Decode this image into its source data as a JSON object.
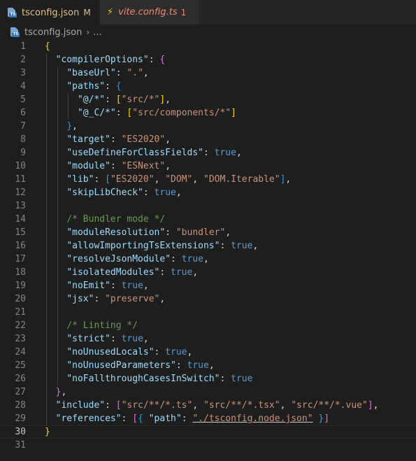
{
  "tabs": [
    {
      "label": "tsconfig.json",
      "status": "M",
      "icon": "ts-file-icon",
      "active": true,
      "dirty": true
    },
    {
      "label": "vite.config.ts",
      "problems": "1",
      "icon": "lightning-bolt-icon",
      "active": false
    }
  ],
  "breadcrumb": {
    "file": "tsconfig.json",
    "separator": "›",
    "ellipsis": "..."
  },
  "lines": [
    {
      "n": "1",
      "indent": 0,
      "tokens": [
        [
          "br1",
          "{"
        ]
      ]
    },
    {
      "n": "2",
      "indent": 2,
      "tokens": [
        [
          "k",
          "\"compilerOptions\""
        ],
        [
          "p",
          ": "
        ],
        [
          "br2",
          "{"
        ]
      ]
    },
    {
      "n": "3",
      "indent": 4,
      "tokens": [
        [
          "k",
          "\"baseUrl\""
        ],
        [
          "p",
          ": "
        ],
        [
          "s",
          "\".\""
        ],
        [
          "p",
          ","
        ]
      ]
    },
    {
      "n": "4",
      "indent": 4,
      "tokens": [
        [
          "k",
          "\"paths\""
        ],
        [
          "p",
          ": "
        ],
        [
          "br3",
          "{"
        ]
      ]
    },
    {
      "n": "5",
      "indent": 6,
      "tokens": [
        [
          "k",
          "\"@/*\""
        ],
        [
          "p",
          ": "
        ],
        [
          "br1",
          "["
        ],
        [
          "s",
          "\"src/*\""
        ],
        [
          "br1",
          "]"
        ],
        [
          "p",
          ","
        ]
      ]
    },
    {
      "n": "6",
      "indent": 6,
      "tokens": [
        [
          "k",
          "\"@_C/*\""
        ],
        [
          "p",
          ": "
        ],
        [
          "br1",
          "["
        ],
        [
          "s",
          "\"src/components/*\""
        ],
        [
          "br1",
          "]"
        ]
      ]
    },
    {
      "n": "7",
      "indent": 4,
      "tokens": [
        [
          "br3",
          "}"
        ],
        [
          "p",
          ","
        ]
      ]
    },
    {
      "n": "8",
      "indent": 4,
      "tokens": [
        [
          "k",
          "\"target\""
        ],
        [
          "p",
          ": "
        ],
        [
          "s",
          "\"ES2020\""
        ],
        [
          "p",
          ","
        ]
      ]
    },
    {
      "n": "9",
      "indent": 4,
      "tokens": [
        [
          "k",
          "\"useDefineForClassFields\""
        ],
        [
          "p",
          ": "
        ],
        [
          "b",
          "true"
        ],
        [
          "p",
          ","
        ]
      ]
    },
    {
      "n": "10",
      "indent": 4,
      "tokens": [
        [
          "k",
          "\"module\""
        ],
        [
          "p",
          ": "
        ],
        [
          "s",
          "\"ESNext\""
        ],
        [
          "p",
          ","
        ]
      ]
    },
    {
      "n": "11",
      "indent": 4,
      "tokens": [
        [
          "k",
          "\"lib\""
        ],
        [
          "p",
          ": "
        ],
        [
          "br3",
          "["
        ],
        [
          "s",
          "\"ES2020\""
        ],
        [
          "p",
          ", "
        ],
        [
          "s",
          "\"DOM\""
        ],
        [
          "p",
          ", "
        ],
        [
          "s",
          "\"DOM.Iterable\""
        ],
        [
          "br3",
          "]"
        ],
        [
          "p",
          ","
        ]
      ]
    },
    {
      "n": "12",
      "indent": 4,
      "tokens": [
        [
          "k",
          "\"skipLibCheck\""
        ],
        [
          "p",
          ": "
        ],
        [
          "b",
          "true"
        ],
        [
          "p",
          ","
        ]
      ]
    },
    {
      "n": "13",
      "indent": 4,
      "tokens": []
    },
    {
      "n": "14",
      "indent": 4,
      "tokens": [
        [
          "c",
          "/* Bundler mode */"
        ]
      ]
    },
    {
      "n": "15",
      "indent": 4,
      "tokens": [
        [
          "k",
          "\"moduleResolution\""
        ],
        [
          "p",
          ": "
        ],
        [
          "s",
          "\"bundler\""
        ],
        [
          "p",
          ","
        ]
      ]
    },
    {
      "n": "16",
      "indent": 4,
      "tokens": [
        [
          "k",
          "\"allowImportingTsExtensions\""
        ],
        [
          "p",
          ": "
        ],
        [
          "b",
          "true"
        ],
        [
          "p",
          ","
        ]
      ]
    },
    {
      "n": "17",
      "indent": 4,
      "tokens": [
        [
          "k",
          "\"resolveJsonModule\""
        ],
        [
          "p",
          ": "
        ],
        [
          "b",
          "true"
        ],
        [
          "p",
          ","
        ]
      ]
    },
    {
      "n": "18",
      "indent": 4,
      "tokens": [
        [
          "k",
          "\"isolatedModules\""
        ],
        [
          "p",
          ": "
        ],
        [
          "b",
          "true"
        ],
        [
          "p",
          ","
        ]
      ]
    },
    {
      "n": "19",
      "indent": 4,
      "tokens": [
        [
          "k",
          "\"noEmit\""
        ],
        [
          "p",
          ": "
        ],
        [
          "b",
          "true"
        ],
        [
          "p",
          ","
        ]
      ]
    },
    {
      "n": "20",
      "indent": 4,
      "tokens": [
        [
          "k",
          "\"jsx\""
        ],
        [
          "p",
          ": "
        ],
        [
          "s",
          "\"preserve\""
        ],
        [
          "p",
          ","
        ]
      ]
    },
    {
      "n": "21",
      "indent": 4,
      "tokens": []
    },
    {
      "n": "22",
      "indent": 4,
      "tokens": [
        [
          "c",
          "/* Linting */"
        ]
      ]
    },
    {
      "n": "23",
      "indent": 4,
      "tokens": [
        [
          "k",
          "\"strict\""
        ],
        [
          "p",
          ": "
        ],
        [
          "b",
          "true"
        ],
        [
          "p",
          ","
        ]
      ]
    },
    {
      "n": "24",
      "indent": 4,
      "tokens": [
        [
          "k",
          "\"noUnusedLocals\""
        ],
        [
          "p",
          ": "
        ],
        [
          "b",
          "true"
        ],
        [
          "p",
          ","
        ]
      ]
    },
    {
      "n": "25",
      "indent": 4,
      "tokens": [
        [
          "k",
          "\"noUnusedParameters\""
        ],
        [
          "p",
          ": "
        ],
        [
          "b",
          "true"
        ],
        [
          "p",
          ","
        ]
      ]
    },
    {
      "n": "26",
      "indent": 4,
      "tokens": [
        [
          "k",
          "\"noFallthroughCasesInSwitch\""
        ],
        [
          "p",
          ": "
        ],
        [
          "b",
          "true"
        ]
      ]
    },
    {
      "n": "27",
      "indent": 2,
      "tokens": [
        [
          "br2",
          "}"
        ],
        [
          "p",
          ","
        ]
      ]
    },
    {
      "n": "28",
      "indent": 2,
      "tokens": [
        [
          "k",
          "\"include\""
        ],
        [
          "p",
          ": "
        ],
        [
          "br2",
          "["
        ],
        [
          "s",
          "\"src/**/*.ts\""
        ],
        [
          "p",
          ", "
        ],
        [
          "s",
          "\"src/**/*.tsx\""
        ],
        [
          "p",
          ", "
        ],
        [
          "s",
          "\"src/**/*.vue\""
        ],
        [
          "br2",
          "]"
        ],
        [
          "p",
          ","
        ]
      ]
    },
    {
      "n": "29",
      "indent": 2,
      "tokens": [
        [
          "k",
          "\"references\""
        ],
        [
          "p",
          ": "
        ],
        [
          "br2",
          "["
        ],
        [
          "br3",
          "{ "
        ],
        [
          "k",
          "\"path\""
        ],
        [
          "p",
          ": "
        ],
        [
          "s",
          "\"./tsconfig.node.json\"",
          "u"
        ],
        [
          "br3",
          " }"
        ],
        [
          "br2",
          "]"
        ]
      ]
    },
    {
      "n": "30",
      "indent": 0,
      "tokens": [
        [
          "br1",
          "}"
        ]
      ],
      "current": true
    },
    {
      "n": "31",
      "indent": 0,
      "tokens": []
    }
  ]
}
